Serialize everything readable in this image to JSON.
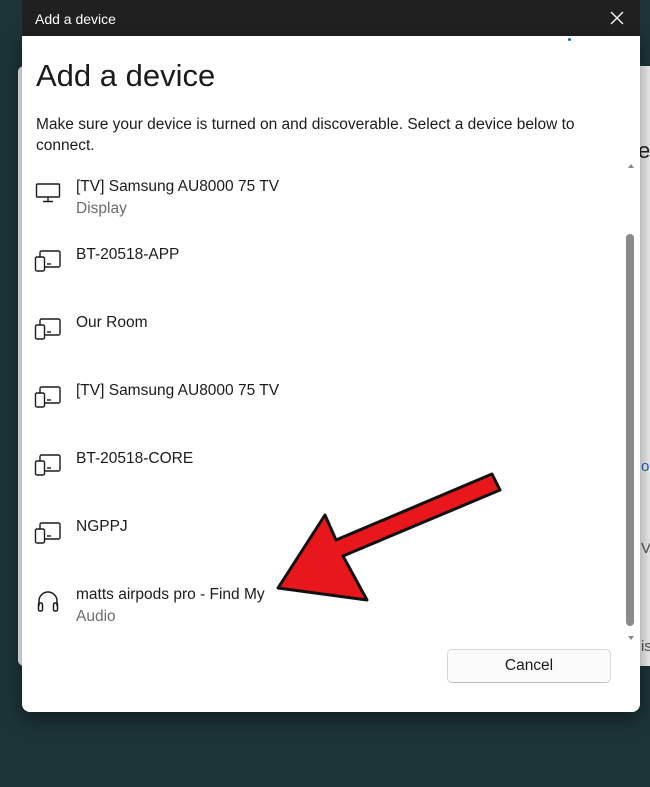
{
  "window": {
    "title": "Add a device",
    "close_icon": "close-icon"
  },
  "dialog": {
    "heading": "Add a device",
    "instructions": "Make sure your device is turned on and discoverable. Select a device below to connect.",
    "cancel_label": "Cancel"
  },
  "devices": [
    {
      "name": "[TV] Samsung AU8000 75 TV",
      "type": "Display",
      "icon": "monitor-icon"
    },
    {
      "name": "BT-20518-APP",
      "type": "",
      "icon": "devices-icon"
    },
    {
      "name": "Our Room",
      "type": "",
      "icon": "devices-icon"
    },
    {
      "name": "[TV] Samsung AU8000 75 TV",
      "type": "",
      "icon": "devices-icon"
    },
    {
      "name": "BT-20518-CORE",
      "type": "",
      "icon": "devices-icon"
    },
    {
      "name": "NGPPJ",
      "type": "",
      "icon": "devices-icon"
    },
    {
      "name": "matts airpods pro - Find My",
      "type": "Audio",
      "icon": "headphones-icon"
    }
  ],
  "background": {
    "partial_text_1": "e",
    "partial_text_2": "o",
    "partial_text_3": "V",
    "partial_text_4": "is"
  },
  "colors": {
    "titlebar": "#202020",
    "backdrop": "#1c3438",
    "annotation_arrow": "#e8171b"
  }
}
